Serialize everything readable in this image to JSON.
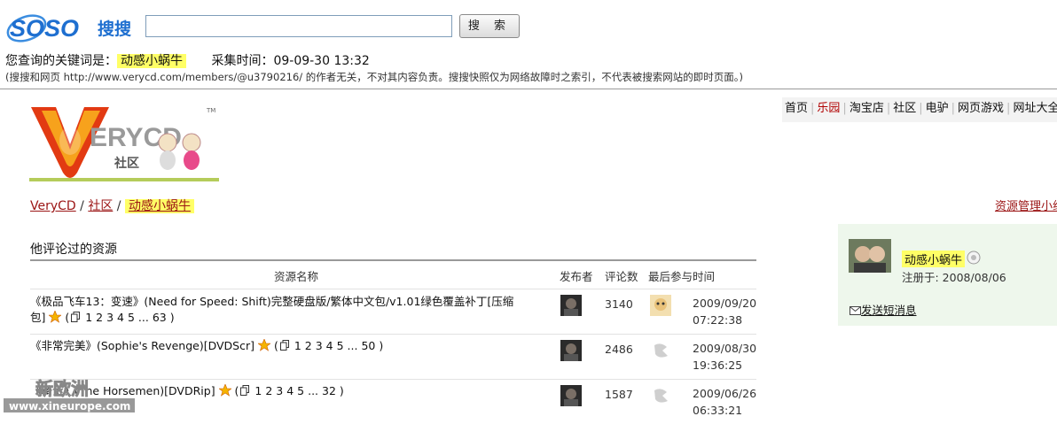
{
  "soso": {
    "logo_text": "SOSO",
    "logo_cn": "搜搜",
    "search_value": "",
    "search_button": "搜 索",
    "query_prefix": "您查询的关键词是：",
    "query_keyword": "动感小蜗牛",
    "capture_label": "采集时间：09-09-30 13:32",
    "disclaimer": "(搜搜和网页 http://www.verycd.com/members/@u3790216/ 的作者无关，不对其内容负责。搜搜快照仅为网络故障时之索引，不代表被搜索网站的即时页面。)"
  },
  "verycd": {
    "logo_text": "ERYCD",
    "logo_sub": "社区",
    "logo_tm": "TM",
    "nav": [
      "首页",
      "乐园",
      "淘宝店",
      "社区",
      "电驴",
      "网页游戏",
      "网址大全"
    ],
    "nav_active_index": 1,
    "breadcrumb": {
      "home": "VeryCD",
      "sep1": " / ",
      "community": "社区",
      "sep2": " / ",
      "user": "动感小蜗牛"
    },
    "resource_manager": "资源管理小组"
  },
  "section": {
    "title": "他评论过的资源",
    "headers": {
      "name": "资源名称",
      "publisher": "发布者",
      "comments": "评论数",
      "last": "最后参与时间"
    }
  },
  "rows": [
    {
      "title": "《极品飞车13：变速》(Need for Speed: Shift)完整硬盘版/繁体中文包/v1.01绿色覆盖补丁[压缩包]",
      "pages": [
        "1",
        "2",
        "3",
        "4",
        "5",
        "...",
        "63"
      ],
      "comments": "3140",
      "date": "2009/09/20",
      "time": "07:22:38"
    },
    {
      "title": "《非常完美》(Sophie's Revenge)[DVDScr]",
      "pages": [
        "1",
        "2",
        "3",
        "4",
        "5",
        "...",
        "50"
      ],
      "comments": "2486",
      "date": "2009/08/30",
      "time": "19:36:25"
    },
    {
      "title": "《骑士》(The Horsemen)[DVDRip]",
      "pages": [
        "1",
        "2",
        "3",
        "4",
        "5",
        "...",
        "32"
      ],
      "comments": "1587",
      "date": "2009/06/26",
      "time": "06:33:21"
    }
  ],
  "sidebar": {
    "username": "动感小蜗牛",
    "register": "注册于: 2008/08/06",
    "send_message": "发送短消息"
  },
  "watermark": {
    "cn": "新欧洲",
    "url": "www.xineurope.com"
  },
  "colors": {
    "link": "#9b1414",
    "highlight": "#ffff66",
    "sidebar_bg": "#eef7ec",
    "soso_blue": "#1e6fd0"
  },
  "icons": {
    "star": "award-star-icon",
    "copy": "copy-pages-icon",
    "status": "online-status-icon",
    "mail": "envelope-icon"
  }
}
